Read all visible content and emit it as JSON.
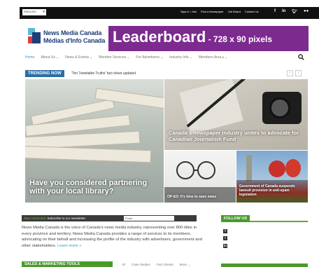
{
  "topbar": {
    "language": "ENGLISH",
    "links": [
      "Sign In / Join",
      "Find a Newspaper",
      "Job Board",
      "Contact Us"
    ],
    "social_icons": [
      "facebook-icon",
      "linkedin-icon",
      "twitter-icon",
      "flickr-icon"
    ]
  },
  "logo": {
    "name_en": "News Media Canada",
    "name_fr": "Médias d'Info Canada"
  },
  "leaderboard": {
    "main": "Leaderboard",
    "sub": " - 728 x 90 pixels",
    "color": "#7d2a8f"
  },
  "nav": {
    "items": [
      {
        "label": "Home",
        "dropdown": false
      },
      {
        "label": "About Us",
        "dropdown": true
      },
      {
        "label": "News & Events",
        "dropdown": true
      },
      {
        "label": "Member Services",
        "dropdown": true
      },
      {
        "label": "For Advertisers",
        "dropdown": true
      },
      {
        "label": "Industry Info",
        "dropdown": true
      },
      {
        "label": "Members Area",
        "dropdown": true,
        "locked": true
      }
    ]
  },
  "trending": {
    "label": "TRENDING NOW",
    "headline": "'Ten Tweetable Truths' fact sheet updated"
  },
  "tiles": {
    "main": "Have you considered partnering with your local library?",
    "top_right": "Canada's newspaper industry unites to advocate for Canadian Journalism Fund",
    "bottom_left": "OP-ED: It's time to save news",
    "bottom_right": "Government of Canada suspends lawsuit provision in anti-spam legislation"
  },
  "newsletter": {
    "lead": "Stay connected.",
    "text": " Subscribe to our newsletter.",
    "placeholder": "Email"
  },
  "about": {
    "text": "News Media Canada is the voice of Canada's news media industry, representing over 800 titles in every province and territory. News Media Canada provides a range of services to its members, advocating on their behalf and increasing the profile of the industry with advertisers, government and other stakeholders.",
    "more": "Learn more »"
  },
  "follow": {
    "label": "FOLLOW US"
  },
  "sales": {
    "label": "SALES & MARKETING TOOLS",
    "filters": [
      "All",
      "Case Studies",
      "Fact Sheets",
      "More"
    ]
  },
  "colors": {
    "accent_blue": "#2a6ea6",
    "accent_green": "#4a9a2c",
    "topbar": "#111111"
  }
}
